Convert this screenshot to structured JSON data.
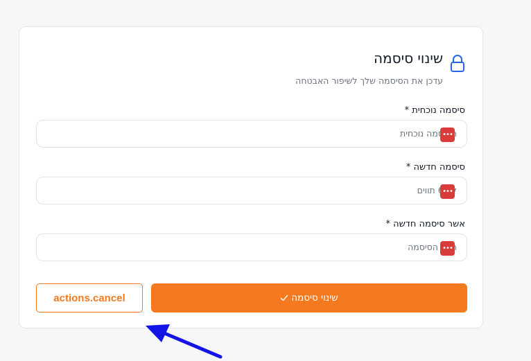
{
  "header": {
    "title": "שינוי סיסמה",
    "subtitle": "עדכן את הסיסמה שלך לשיפור האבטחה",
    "icon": "lock-icon"
  },
  "fields": [
    {
      "label": "סיסמה נוכחית *",
      "placeholder": "הסיסמה נוכחית"
    },
    {
      "label": "סיסמה חדשה *",
      "placeholder": "לת 6 תווים"
    },
    {
      "label": "אשר סיסמה חדשה *",
      "placeholder": "העל הסיסמה"
    }
  ],
  "password_manager_icon": "password-manager-icon",
  "actions": {
    "cancel_label": "actions.cancel",
    "submit_label": "שינוי סיסמה"
  },
  "colors": {
    "accent": "#f57a1f",
    "icon_blue": "#2563eb",
    "pm_red": "#d93a3a",
    "annotation_arrow": "#1414e6"
  }
}
